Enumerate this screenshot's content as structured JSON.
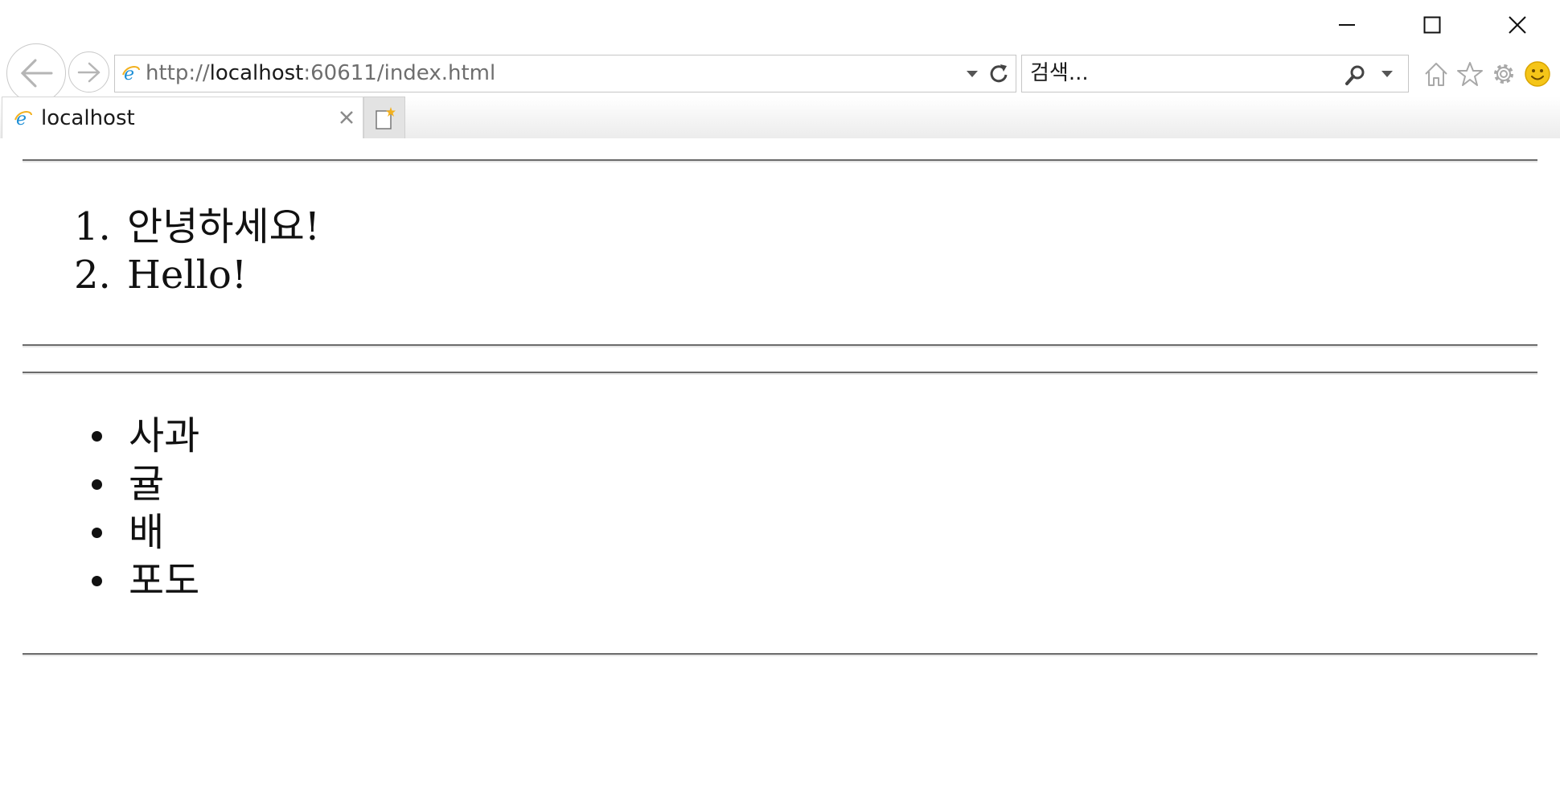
{
  "window": {
    "controls": [
      "minimize",
      "maximize",
      "close"
    ]
  },
  "address_bar": {
    "scheme": "http://",
    "host": "localhost",
    "rest": ":60611/index.html"
  },
  "search": {
    "placeholder": "검색..."
  },
  "tab": {
    "label": "localhost"
  },
  "page": {
    "ordered_list": [
      {
        "number": "1.",
        "text": "안녕하세요!"
      },
      {
        "number": "2.",
        "text": "Hello!"
      }
    ],
    "unordered_list": [
      {
        "text": "사과"
      },
      {
        "text": "귤"
      },
      {
        "text": "배"
      },
      {
        "text": "포도"
      }
    ]
  },
  "colors": {
    "rule": "#6b6b6b",
    "icon_gray": "#8a8a8a",
    "ie_blue": "#1e8fd6",
    "ie_gold": "#f2b01e",
    "smiley": "#f5c518"
  },
  "icons": {
    "back": "back-arrow-icon",
    "forward": "forward-arrow-icon",
    "favicon": "ie-logo-icon",
    "refresh": "refresh-icon",
    "search": "search-icon",
    "home": "home-icon",
    "favorites": "star-icon",
    "tools": "gear-icon",
    "feedback": "smiley-icon"
  }
}
